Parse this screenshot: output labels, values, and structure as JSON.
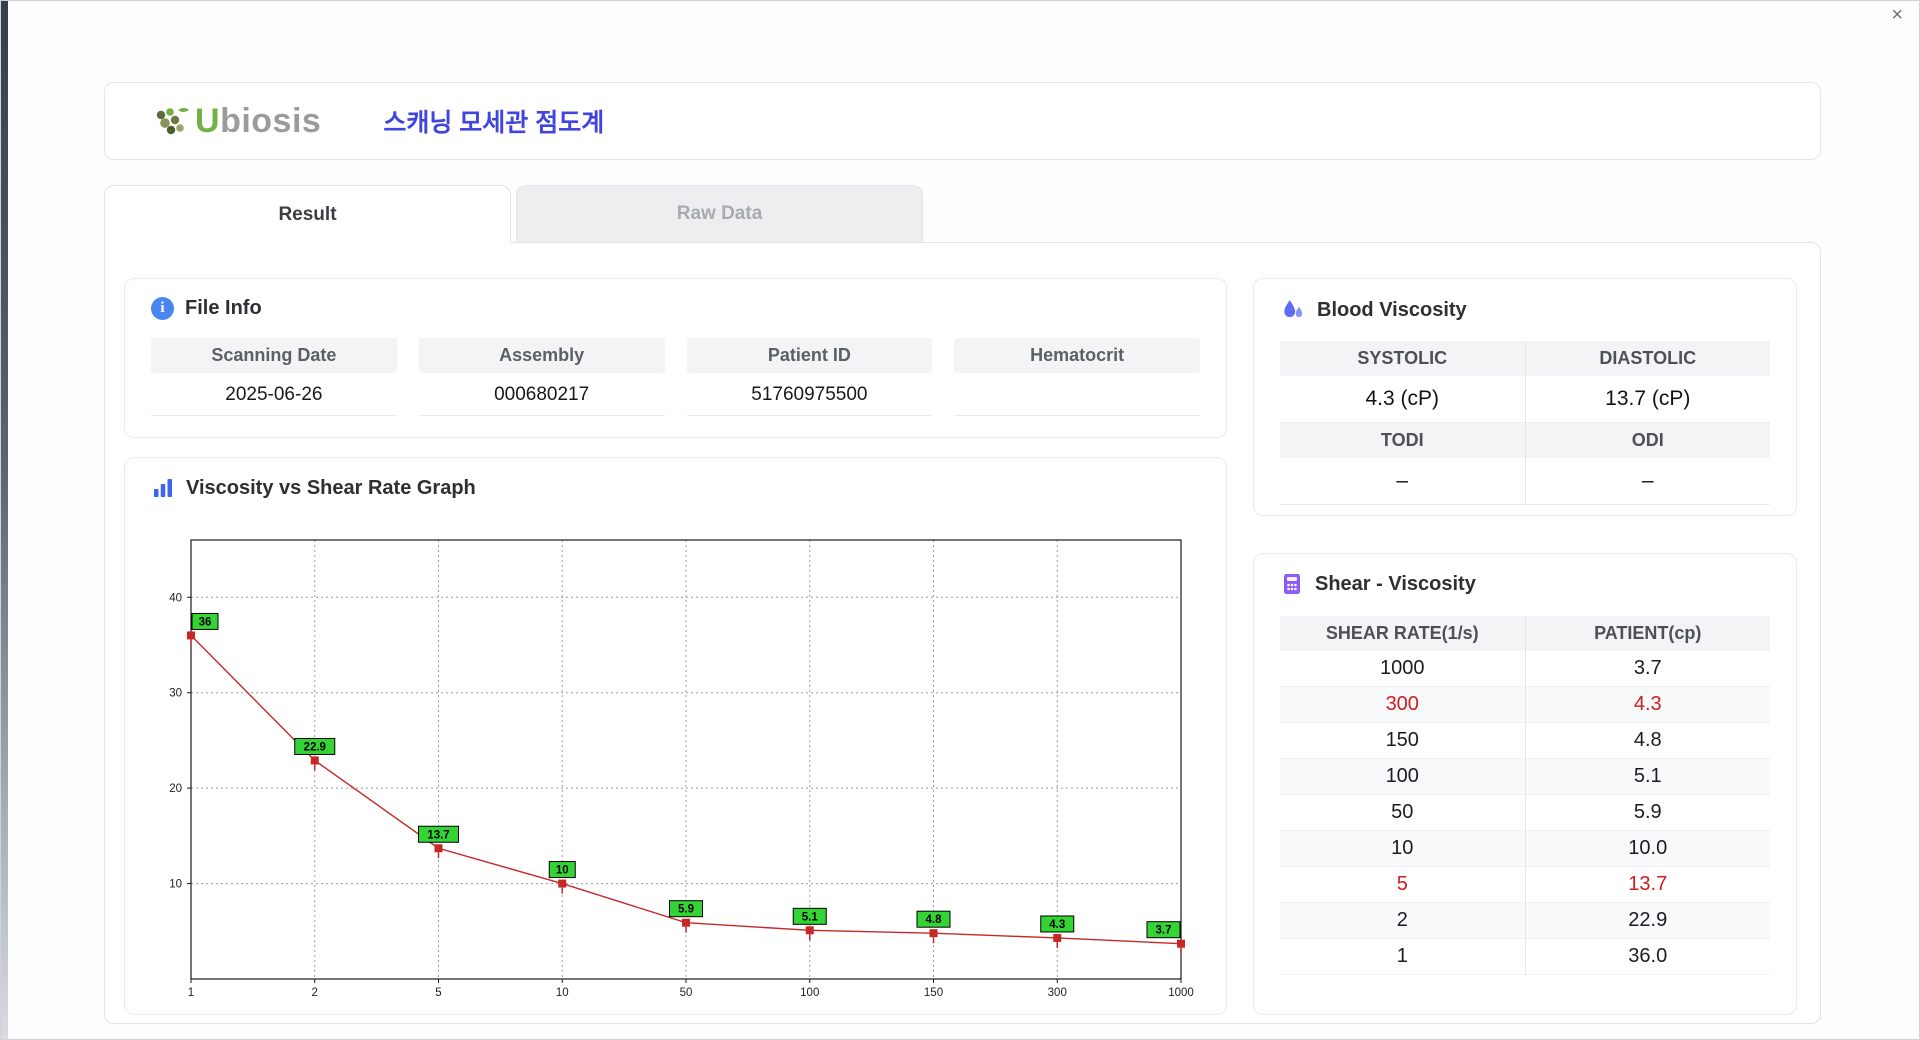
{
  "window": {
    "close_glyph": "×"
  },
  "header": {
    "brand_first_letter": "U",
    "brand_rest": "biosis",
    "title": "스캐닝 모세관 점도계"
  },
  "tabs": [
    {
      "label": "Result",
      "active": true
    },
    {
      "label": "Raw Data",
      "active": false
    }
  ],
  "file_info": {
    "section_title": "File Info",
    "info_glyph": "i",
    "fields": [
      {
        "label": "Scanning Date",
        "value": "2025-06-26"
      },
      {
        "label": "Assembly",
        "value": "000680217"
      },
      {
        "label": "Patient ID",
        "value": "51760975500"
      },
      {
        "label": "Hematocrit",
        "value": ""
      }
    ]
  },
  "graph_section": {
    "title": "Viscosity vs Shear Rate Graph"
  },
  "blood_viscosity": {
    "section_title": "Blood Viscosity",
    "systolic_label": "SYSTOLIC",
    "systolic_value": "4.3 (cP)",
    "diastolic_label": "DIASTOLIC",
    "diastolic_value": "13.7 (cP)",
    "todi_label": "TODI",
    "todi_value": "–",
    "odi_label": "ODI",
    "odi_value": "–"
  },
  "shear_viscosity": {
    "section_title": "Shear - Viscosity",
    "columns": [
      "SHEAR RATE(1/s)",
      "PATIENT(cp)"
    ],
    "highlight_color": "#cf1d1d",
    "rows": [
      {
        "shear_rate": "1000",
        "patient": "3.7",
        "highlight": false
      },
      {
        "shear_rate": "300",
        "patient": "4.3",
        "highlight": true
      },
      {
        "shear_rate": "150",
        "patient": "4.8",
        "highlight": false
      },
      {
        "shear_rate": "100",
        "patient": "5.1",
        "highlight": false
      },
      {
        "shear_rate": "50",
        "patient": "5.9",
        "highlight": false
      },
      {
        "shear_rate": "10",
        "patient": "10.0",
        "highlight": false
      },
      {
        "shear_rate": "5",
        "patient": "13.7",
        "highlight": true
      },
      {
        "shear_rate": "2",
        "patient": "22.9",
        "highlight": false
      },
      {
        "shear_rate": "1",
        "patient": "36.0",
        "highlight": false
      }
    ]
  },
  "chart_data": {
    "type": "line",
    "title": "Viscosity vs Shear Rate Graph",
    "xlabel": "",
    "ylabel": "",
    "x": [
      1,
      2,
      5,
      10,
      50,
      100,
      150,
      300,
      1000
    ],
    "x_tick_labels": [
      "1",
      "2",
      "5",
      "10",
      "50",
      "100",
      "150",
      "300",
      "1000"
    ],
    "values": [
      36,
      22.9,
      13.7,
      10,
      5.9,
      5.1,
      4.8,
      4.3,
      3.7
    ],
    "point_labels": [
      "36",
      "22.9",
      "13.7",
      "10",
      "5.9",
      "5.1",
      "4.8",
      "4.3",
      "3.7"
    ],
    "y_ticks": [
      10,
      20,
      30,
      40
    ],
    "ylim": [
      0,
      46
    ],
    "grid": "dashed",
    "legend": false,
    "x_axis_note": "ticks evenly spaced (log-like category axis)",
    "line_color": "#c62828",
    "marker_color": "#c62828",
    "label_bg": "#35d435",
    "label_border": "#000000"
  }
}
